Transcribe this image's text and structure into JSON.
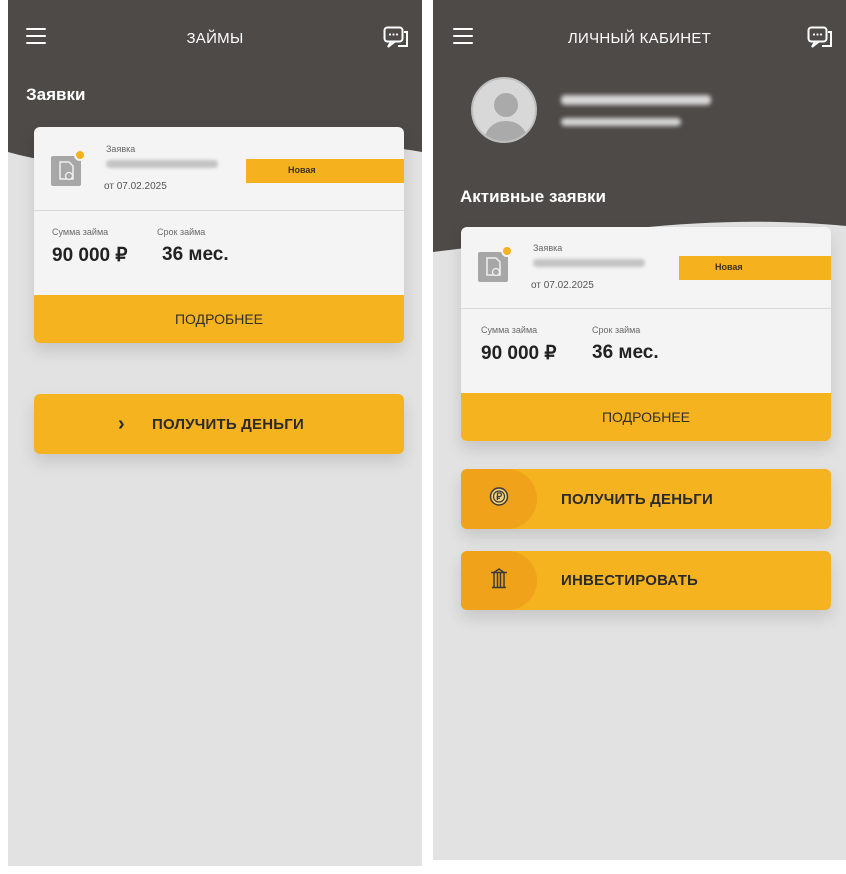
{
  "left": {
    "header_title": "ЗАЙМЫ",
    "section_title": "Заявки",
    "card": {
      "app_label": "Заявка",
      "date": "от 07.02.2025",
      "status": "Новая",
      "sum_label": "Сумма займа",
      "sum_value": "90 000 ₽",
      "term_label": "Срок займа",
      "term_value": "36 мес.",
      "details_label": "ПОДРОБНЕЕ"
    },
    "get_money_button": {
      "chevron": "›",
      "label": "ПОЛУЧИТЬ ДЕНЬГИ"
    }
  },
  "right": {
    "header_title": "ЛИЧНЫЙ КАБИНЕТ",
    "section_title": "Активные заявки",
    "card": {
      "app_label": "Заявка",
      "date": "от 07.02.2025",
      "status": "Новая",
      "sum_label": "Сумма займа",
      "sum_value": "90 000 ₽",
      "term_label": "Срок займа",
      "term_value": "36 мес.",
      "details_label": "ПОДРОБНЕЕ"
    },
    "get_money_button": {
      "label": "ПОЛУЧИТЬ ДЕНЬГИ",
      "icon": "ruble-coin-icon"
    },
    "invest_button": {
      "label": "ИНВЕСТИРОВАТЬ",
      "icon": "bank-icon"
    }
  },
  "icons": {
    "menu": "hamburger-icon",
    "chat": "chat-icon",
    "document": "document-icon"
  },
  "colors": {
    "header": "#4d4a48",
    "accent": "#f6b320",
    "background": "#e2e2e2"
  }
}
